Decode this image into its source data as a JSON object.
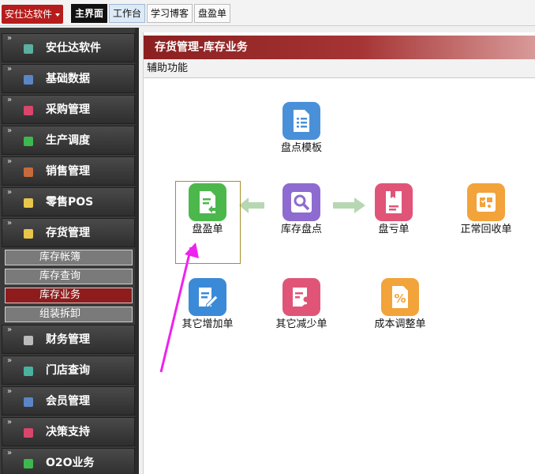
{
  "app_menu": {
    "label": "安仕达软件"
  },
  "tabs": [
    {
      "label": "主界面"
    },
    {
      "label": "工作台"
    },
    {
      "label": "学习博客"
    },
    {
      "label": "盘盈单"
    }
  ],
  "sidebar": {
    "items": [
      {
        "label": "安仕达软件",
        "icon": "app-icon",
        "color": "#5ab0a0"
      },
      {
        "label": "基础数据",
        "icon": "database-icon",
        "color": "#5b86c6"
      },
      {
        "label": "采购管理",
        "icon": "purchase-icon",
        "color": "#d9466b"
      },
      {
        "label": "生产调度",
        "icon": "production-icon",
        "color": "#3db84f"
      },
      {
        "label": "销售管理",
        "icon": "sales-icon",
        "color": "#c66a3c"
      },
      {
        "label": "零售POS",
        "icon": "pos-icon",
        "color": "#e8c64a"
      },
      {
        "label": "存货管理",
        "icon": "inventory-icon",
        "color": "#e8c64a"
      },
      {
        "label": "财务管理",
        "icon": "finance-icon",
        "color": "#bbbbbb"
      },
      {
        "label": "门店查询",
        "icon": "store-icon",
        "color": "#4ab0a0"
      },
      {
        "label": "会员管理",
        "icon": "member-icon",
        "color": "#5b86c6"
      },
      {
        "label": "决策支持",
        "icon": "decision-icon",
        "color": "#d9466b"
      },
      {
        "label": "O2O业务",
        "icon": "o2o-icon",
        "color": "#3db84f"
      }
    ],
    "sub_items": [
      {
        "label": "库存帐簿"
      },
      {
        "label": "库存查询"
      },
      {
        "label": "库存业务",
        "active": true
      },
      {
        "label": "组装拆卸"
      }
    ]
  },
  "panel": {
    "title": "存货管理-库存业务",
    "aux_label": "辅助功能"
  },
  "functions": {
    "count_template": {
      "label": "盘点模板",
      "color": "#4a90d9",
      "icon": "document-list-icon"
    },
    "surplus": {
      "label": "盘盈单",
      "color": "#4cb84c",
      "icon": "surplus-doc-icon"
    },
    "stocktake": {
      "label": "库存盘点",
      "color": "#8e6bd0",
      "icon": "magnify-icon"
    },
    "loss": {
      "label": "盘亏单",
      "color": "#e05577",
      "icon": "loss-doc-icon"
    },
    "recycle": {
      "label": "正常回收单",
      "color": "#f2a33a",
      "icon": "recycle-icon"
    },
    "other_increase": {
      "label": "其它增加单",
      "color": "#3b8ad8",
      "icon": "edit-doc-icon"
    },
    "other_decrease": {
      "label": "其它减少单",
      "color": "#e05577",
      "icon": "person-doc-icon"
    },
    "cost_adjust": {
      "label": "成本调整单",
      "color": "#f2a33a",
      "icon": "percent-doc-icon"
    }
  },
  "colors": {
    "flow_arrow": "#b6d7b2",
    "annotation_arrow": "#ee22ee",
    "accent": "#a33030"
  }
}
